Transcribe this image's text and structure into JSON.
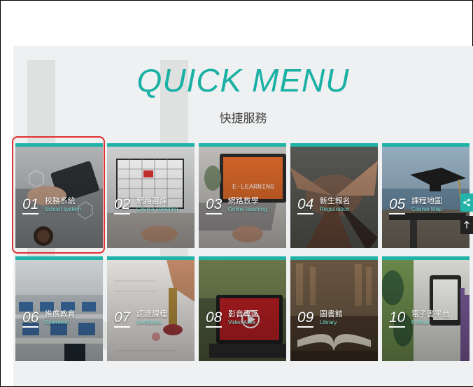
{
  "header": {
    "title": "QUICK MENU",
    "subtitle": "快捷服務"
  },
  "tiles": [
    {
      "num": "01",
      "zh": "校務系統",
      "en": "School system",
      "theme": "tablet-hands"
    },
    {
      "num": "02",
      "zh": "網路選課",
      "en": "Course selection",
      "theme": "calendar"
    },
    {
      "num": "03",
      "zh": "網路教學",
      "en": "Online teaching",
      "theme": "elearning"
    },
    {
      "num": "04",
      "zh": "新生報名",
      "en": "Registration",
      "theme": "hands-together"
    },
    {
      "num": "05",
      "zh": "課程地圖",
      "en": "Course Map",
      "theme": "grad-cap"
    },
    {
      "num": "06",
      "zh": "推廣教育",
      "en": "Extension",
      "theme": "classroom"
    },
    {
      "num": "07",
      "zh": "認證課程",
      "en": "Certificate",
      "theme": "wax-seal"
    },
    {
      "num": "08",
      "zh": "影音專區",
      "en": "Video Area",
      "theme": "video"
    },
    {
      "num": "09",
      "zh": "圖書館",
      "en": "Library",
      "theme": "book"
    },
    {
      "num": "10",
      "zh": "電子書平台",
      "en": "E-Book",
      "theme": "ereader"
    }
  ],
  "side": {
    "share_icon": "share-icon",
    "top_icon": "arrow-up-icon"
  },
  "colors": {
    "accent": "#1ab0a4",
    "highlight": "#e03030",
    "panel": "#eef0f1"
  }
}
